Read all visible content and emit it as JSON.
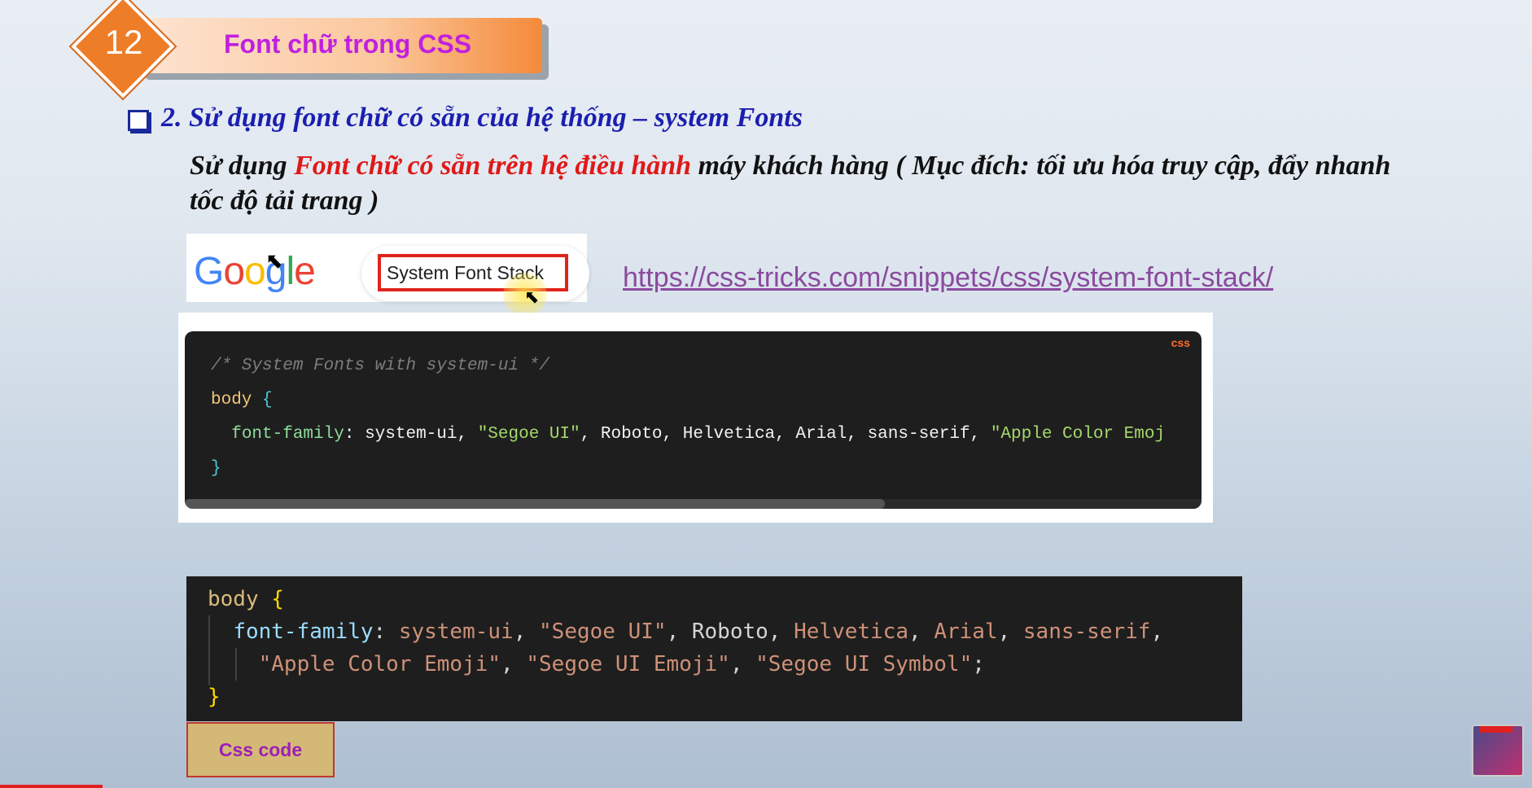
{
  "header": {
    "number": "12",
    "title": "Font chữ trong CSS"
  },
  "section": {
    "heading": "2. Sử dụng font chữ có sẵn của hệ thống – system Fonts",
    "desc_prefix": "Sử dụng ",
    "desc_highlight": "Font chữ có sẵn trên hệ điều hành",
    "desc_suffix": " máy khách hàng ( Mục đích: tối ưu hóa truy cập, đẩy nhanh tốc độ tải trang )"
  },
  "search": {
    "logo_letters": [
      "G",
      "o",
      "o",
      "g",
      "l",
      "e"
    ],
    "query": "System Font Stack"
  },
  "link": {
    "url": "https://css-tricks.com/snippets/css/system-font-stack/"
  },
  "code_block_1": {
    "lang_tag": "css",
    "comment": "/* System Fonts with system-ui */",
    "selector": "body",
    "open_brace": "{",
    "property": "font-family",
    "colon": ": ",
    "values": "system-ui, ",
    "str1": "\"Segoe UI\"",
    "values2": ", Roboto, Helvetica, Arial, sans-serif, ",
    "str2": "\"Apple Color Emoj",
    "close_brace": "}"
  },
  "code_block_2": {
    "selector": "body",
    "open_brace": "{",
    "property": "font-family",
    "colon": ": ",
    "v1": "system-ui",
    "sep1": ", ",
    "s1": "\"Segoe UI\"",
    "sep2": ", ",
    "v2": "Roboto",
    "sep3": ", ",
    "v3": "Helvetica",
    "sep4": ", ",
    "v4": "Arial",
    "sep5": ", ",
    "v5": "sans-serif",
    "sep6": ",",
    "s2": "\"Apple Color Emoji\"",
    "sep7": ", ",
    "s3": "\"Segoe UI Emoji\"",
    "sep8": ", ",
    "s4": "\"Segoe UI Symbol\"",
    "end": ";",
    "close_brace": "}"
  },
  "caption": {
    "label": "Css code"
  }
}
